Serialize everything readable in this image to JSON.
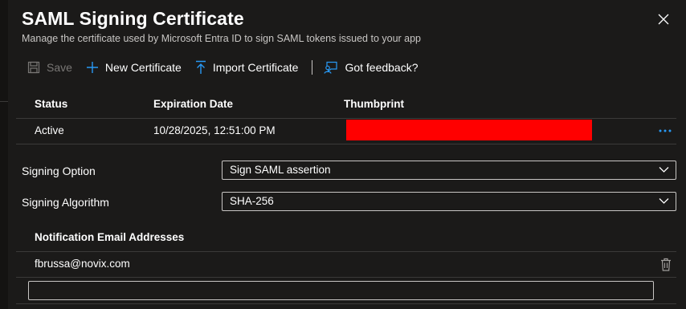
{
  "dialog": {
    "title": "SAML Signing Certificate",
    "subtitle": "Manage the certificate used by Microsoft Entra ID to sign SAML tokens issued to your app"
  },
  "toolbar": {
    "save_label": "Save",
    "new_certificate_label": "New Certificate",
    "import_certificate_label": "Import Certificate",
    "feedback_label": "Got feedback?"
  },
  "certificates": {
    "headers": [
      "Status",
      "Expiration Date",
      "Thumbprint"
    ],
    "rows": [
      {
        "status": "Active",
        "expiration": "10/28/2025, 12:51:00 PM",
        "thumbprint": ""
      }
    ]
  },
  "signing_option": {
    "label": "Signing Option",
    "value": "Sign SAML assertion"
  },
  "signing_algorithm": {
    "label": "Signing Algorithm",
    "value": "SHA-256"
  },
  "notification": {
    "header": "Notification Email Addresses",
    "emails": [
      "fbrussa@novix.com"
    ],
    "new_email_value": ""
  },
  "colors": {
    "background": "#1b1a19",
    "accent": "#2899f5",
    "redaction": "#ff0000",
    "border": "#c8c6c4"
  },
  "icons": {
    "save": "save-icon",
    "new": "plus-icon",
    "import": "upload-icon",
    "feedback": "feedback-icon",
    "close": "close-icon",
    "more": "more-icon",
    "delete": "trash-icon",
    "dropdown": "chevron-down-icon"
  }
}
